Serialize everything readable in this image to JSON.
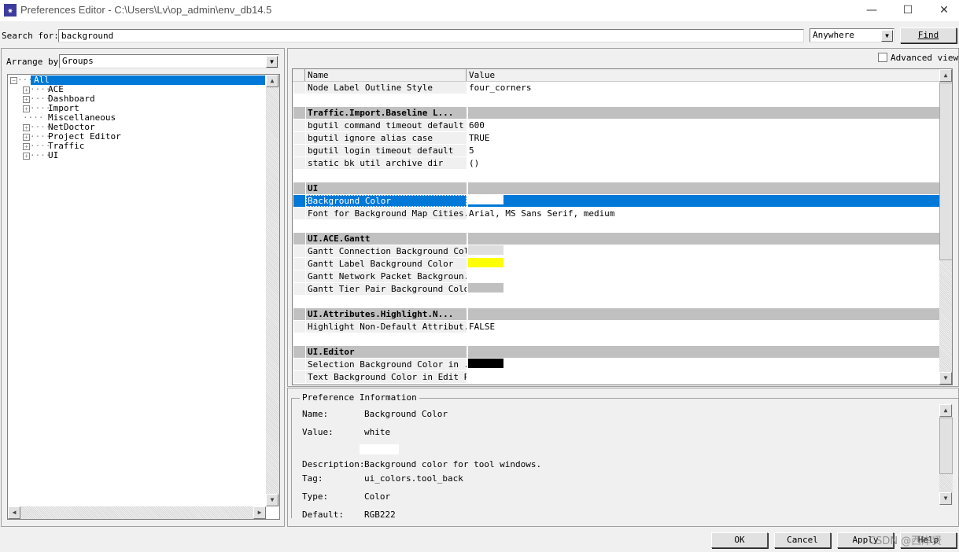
{
  "window": {
    "title": "Preferences Editor - C:\\Users\\Lv\\op_admin\\env_db14.5",
    "minimize": "—",
    "maximize": "☐",
    "close": "✕"
  },
  "search": {
    "label": "Search for:",
    "value": "background",
    "scope": "Anywhere",
    "find_label": "Find"
  },
  "left": {
    "arrange_label": "Arrange by",
    "arrange_value": "Groups",
    "tree": [
      {
        "label": "All",
        "expander": "−",
        "selected": true,
        "level": 0
      },
      {
        "label": "ACE",
        "expander": "+",
        "level": 1
      },
      {
        "label": "Dashboard",
        "expander": "+",
        "level": 1
      },
      {
        "label": "Import",
        "expander": "+",
        "level": 1
      },
      {
        "label": "Miscellaneous",
        "expander": "",
        "level": 1
      },
      {
        "label": "NetDoctor",
        "expander": "+",
        "level": 1
      },
      {
        "label": "Project Editor",
        "expander": "+",
        "level": 1
      },
      {
        "label": "Traffic",
        "expander": "+",
        "level": 1
      },
      {
        "label": "UI",
        "expander": "+",
        "level": 1
      }
    ]
  },
  "right": {
    "advanced_view_label": "Advanced view",
    "advanced_view_checked": false,
    "columns": {
      "name": "Name",
      "value": "Value"
    },
    "rows": [
      {
        "type": "item",
        "name": "Node Label Outline Style",
        "value": "four_corners"
      },
      {
        "type": "blank"
      },
      {
        "type": "group",
        "name": "Traffic.Import.Baseline L..."
      },
      {
        "type": "item",
        "name": "bgutil command timeout default",
        "value": "600"
      },
      {
        "type": "item",
        "name": "bgutil ignore alias case",
        "value": "TRUE"
      },
      {
        "type": "item",
        "name": "bgutil login timeout default",
        "value": "5"
      },
      {
        "type": "item",
        "name": "static bk util archive dir",
        "value": "()"
      },
      {
        "type": "blank"
      },
      {
        "type": "group",
        "name": "UI"
      },
      {
        "type": "item",
        "name": "Background Color",
        "swatch": "#ffffff",
        "selected": true
      },
      {
        "type": "item",
        "name": "Font for Background Map Cities...",
        "value": "Arial, MS Sans Serif, medium"
      },
      {
        "type": "blank"
      },
      {
        "type": "group",
        "name": "UI.ACE.Gantt"
      },
      {
        "type": "item",
        "name": "Gantt Connection Background Color",
        "swatch": "#dedede"
      },
      {
        "type": "item",
        "name": "Gantt Label Background Color",
        "swatch": "#ffff00"
      },
      {
        "type": "item",
        "name": "Gantt Network Packet Backgroun...",
        "swatch": "#ffffff"
      },
      {
        "type": "item",
        "name": "Gantt Tier Pair Background Color",
        "swatch": "#c0c0c0"
      },
      {
        "type": "blank"
      },
      {
        "type": "group",
        "name": "UI.Attributes.Highlight.N..."
      },
      {
        "type": "item",
        "name": "Highlight Non-Default Attribut...",
        "value": "FALSE"
      },
      {
        "type": "blank"
      },
      {
        "type": "group",
        "name": "UI.Editor"
      },
      {
        "type": "item",
        "name": "Selection Background Color in ...",
        "swatch": "#000000"
      },
      {
        "type": "item",
        "name": "Text Background Color in Edit Pad",
        "swatch": "#ffffff"
      }
    ]
  },
  "info": {
    "title": "Preference Information",
    "name_label": "Name:",
    "name": "Background Color",
    "value_label": "Value:",
    "value": "white",
    "value_swatch": "#ffffff",
    "description_label": "Description:",
    "description": "Background color for tool windows.",
    "tag_label": "Tag:",
    "tag": "ui_colors.tool_back",
    "type_label": "Type:",
    "type": "Color",
    "default_label": "Default:",
    "default": "RGB222"
  },
  "buttons": {
    "ok": "OK",
    "cancel": "Cancel",
    "apply": "Apply",
    "help": "Help"
  },
  "watermark": "CSDN @西岸贤",
  "colors": {
    "selection": "#0078d7",
    "group_header": "#c0c0c0"
  }
}
